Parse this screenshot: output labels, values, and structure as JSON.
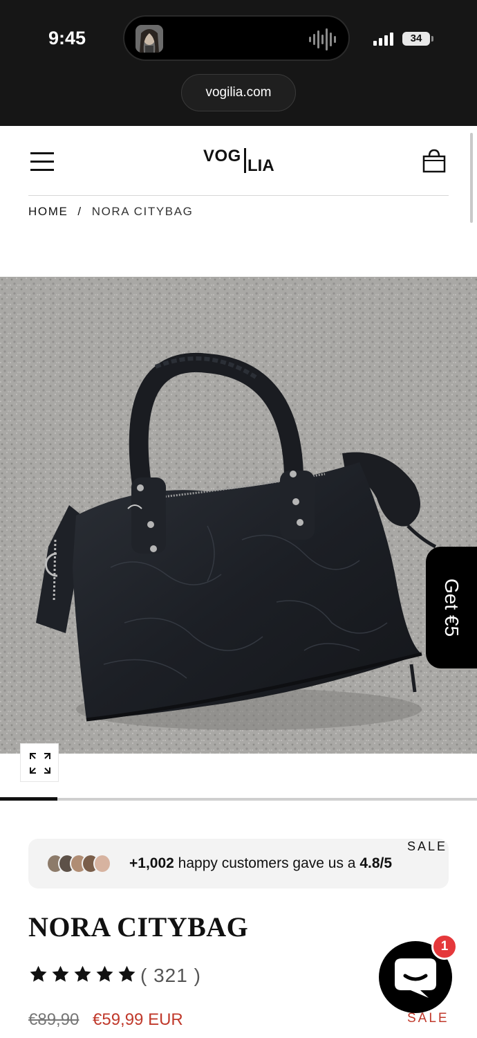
{
  "status_bar": {
    "time": "9:45",
    "battery": "34",
    "url": "vogilia.com"
  },
  "header": {
    "logo_part1": "VOG",
    "logo_part2": "LIA",
    "menu_icon": "hamburger-menu-icon",
    "cart_icon": "shopping-bag-icon"
  },
  "breadcrumb": {
    "home": "HOME",
    "separator": "/",
    "current": "NORA CITYBAG"
  },
  "product_image": {
    "zoom_icon": "expand-icon"
  },
  "promo_tab": {
    "label": "Get €5"
  },
  "gallery": {
    "progress": 0.12
  },
  "social_proof": {
    "count": "+1,002",
    "text_mid": " happy customers gave us a ",
    "rating": "4.8/5"
  },
  "product": {
    "badge_top": "SALE",
    "title": "NORA CITYBAG",
    "stars": 5,
    "reviews": "( 321 )",
    "price_old": "€89,90",
    "price_new": "€59,99 EUR",
    "badge_bottom": "SALE"
  },
  "chat": {
    "badge": "1",
    "icon": "chat-icon"
  },
  "colors": {
    "status_bg": "#161616",
    "sale_red": "#c0392b",
    "badge_red": "#e5383b",
    "proof_bg": "#f3f3f3"
  }
}
